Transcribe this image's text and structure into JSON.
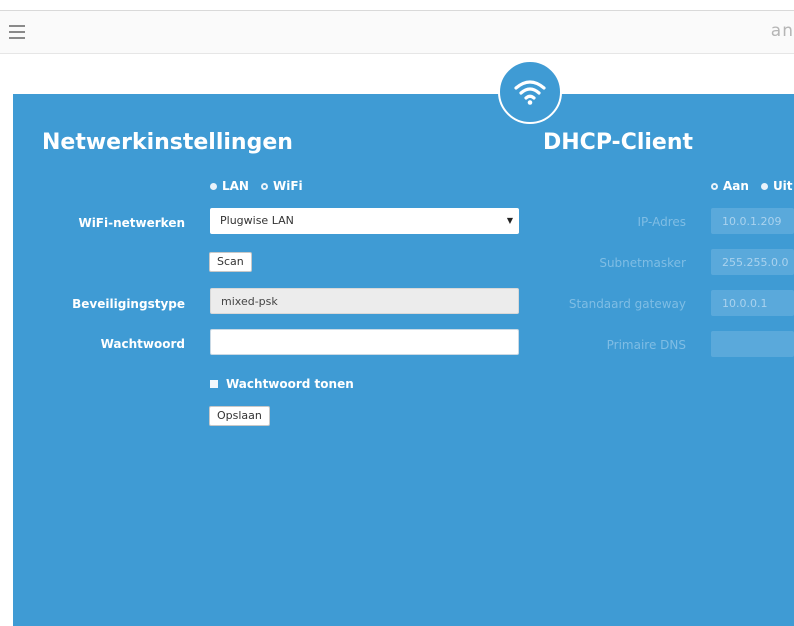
{
  "header": {
    "brand": "an"
  },
  "network": {
    "title": "Netwerkinstellingen",
    "connection_options": [
      {
        "label": "LAN",
        "selected": false
      },
      {
        "label": "WiFi",
        "selected": true
      }
    ],
    "wifi_networks_label": "WiFi-netwerken",
    "wifi_network_value": "Plugwise LAN",
    "scan_button": "Scan",
    "security_label": "Beveiligingstype",
    "security_value": "mixed-psk",
    "password_label": "Wachtwoord",
    "password_value": "",
    "show_password_label": "Wachtwoord tonen",
    "save_button": "Opslaan"
  },
  "dhcp": {
    "title": "DHCP-Client",
    "options": [
      {
        "label": "Aan",
        "selected": true
      },
      {
        "label": "Uit",
        "selected": false
      }
    ],
    "ip_label": "IP-Adres",
    "ip_value": "10.0.1.209",
    "subnet_label": "Subnetmasker",
    "subnet_value": "255.255.0.0",
    "gateway_label": "Standaard gateway",
    "gateway_value": "10.0.0.1",
    "dns_label": "Primaire DNS",
    "dns_value": ""
  },
  "icons": {
    "menu": "hamburger-icon",
    "wifi": "wifi-icon"
  },
  "colors": {
    "panel": "#3f9bd4",
    "topbar": "#fafafa"
  }
}
